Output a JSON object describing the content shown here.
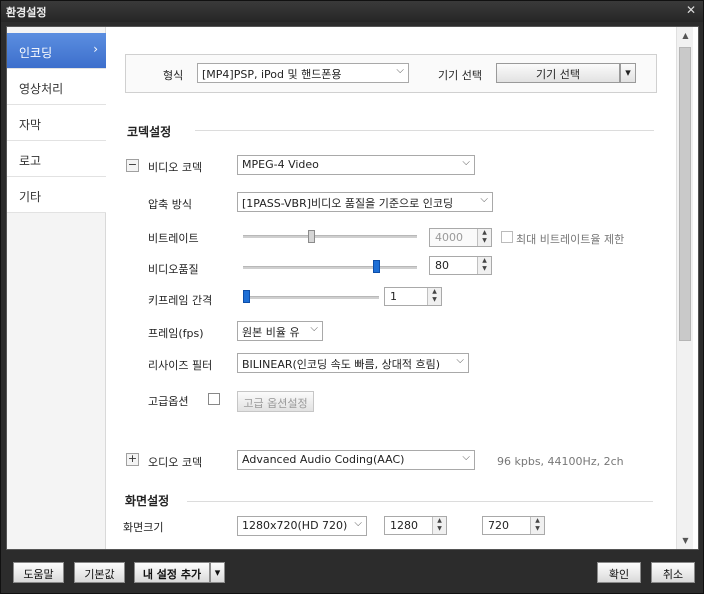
{
  "window": {
    "title": "환경설정",
    "close_glyph": "✕"
  },
  "sidebar": {
    "items": [
      {
        "label": "인코딩",
        "active": true
      },
      {
        "label": "영상처리"
      },
      {
        "label": "자막"
      },
      {
        "label": "로고"
      },
      {
        "label": "기타"
      }
    ],
    "active_chevron": "›"
  },
  "format_row": {
    "format_label": "형식",
    "format_value": "[MP4]PSP, iPod 및 핸드폰용",
    "device_label": "기기 선택",
    "device_button": "기기 선택"
  },
  "codec_section": {
    "heading": "코덱설정",
    "video_codec": {
      "toggle": "−",
      "label": "비디오 코덱",
      "value": "MPEG-4 Video"
    },
    "compression": {
      "label": "압축 방식",
      "value": "[1PASS-VBR]비디오 품질을 기준으로 인코딩"
    },
    "bitrate": {
      "label": "비트레이트",
      "value": "4000",
      "slider_fraction": 0.39,
      "enabled": false,
      "max_limit_label": "최대 비트레이트율 제한",
      "max_limit_checked": false
    },
    "video_quality": {
      "label": "비디오품질",
      "value": "80",
      "slider_fraction": 0.78
    },
    "keyframe": {
      "label": "키프레임 간격",
      "value": "1",
      "slider_fraction": 0.0
    },
    "framerate": {
      "label": "프레임(fps)",
      "value": "원본 비율 유"
    },
    "resize_filter": {
      "label": "리사이즈 필터",
      "value": "BILINEAR(인코딩 속도 빠름, 상대적 흐림)"
    },
    "advanced": {
      "label": "고급옵션",
      "checked": false,
      "button": "고급 옵션설정"
    },
    "audio_codec": {
      "toggle": "+",
      "label": "오디오 코덱",
      "value": "Advanced Audio Coding(AAC)",
      "info": "96 kpbs, 44100Hz, 2ch"
    }
  },
  "screen_section": {
    "heading": "화면설정",
    "size_label": "화면크기",
    "size_value": "1280x720(HD 720)",
    "width": "1280",
    "height": "720"
  },
  "footer": {
    "help": "도움말",
    "default": "기본값",
    "add_preset": "내 설정 추가",
    "ok": "확인",
    "cancel": "취소"
  },
  "glyphs": {
    "combo_arrow": "⌵",
    "dropdown_arrow": "▾",
    "spin_up": "▲",
    "spin_down": "▼",
    "scroll_up": "▲",
    "scroll_down": "▼"
  },
  "colors": {
    "sidebar_active": "#4a7fd8",
    "window_bg": "#2c2c2c",
    "slider_thumb_active": "#1e6fd6"
  }
}
